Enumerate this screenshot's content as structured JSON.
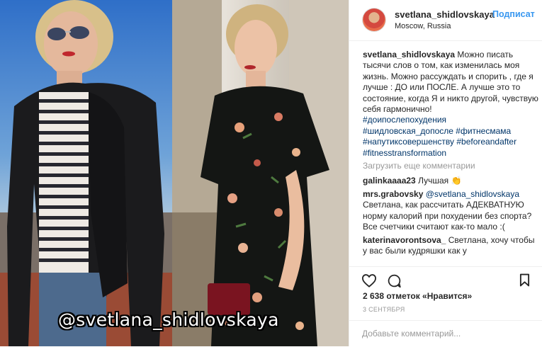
{
  "post": {
    "username": "svetlana_shidlovskaya",
    "follow_label": "Подписат",
    "location": "Moscow, Russia",
    "watermark": "@svetlana_shidlovskaya"
  },
  "caption": {
    "author": "svetlana_shidlovskaya",
    "text": "Можно писать тысячи слов о том, как изменилась моя жизнь. Можно рассуждать и спорить , где я лучше : ДО или ПОСЛЕ. А лучше это то состояние, когда Я и никто другой, чувствую себя гармонично!",
    "hashtags": [
      "#доипослепохудения",
      "#шидловская_допосле",
      "#фитнесмама",
      "#напутиксовершенству",
      "#beforeandafter",
      "#fitnesstransformation"
    ]
  },
  "load_more_label": "Загрузить еще комментарии",
  "comments": [
    {
      "author": "galinkaaaa23",
      "text": "Лучшая 👏"
    },
    {
      "author": "mrs.grabovsky",
      "mention": "@svetlana_shidlovskaya",
      "text": "Светлана, как рассчитать АДЕКВАТНУЮ норму калорий при похудении без спорта? Все счетчики считают как-то мало :("
    },
    {
      "author": "katerinavorontsova_",
      "text": "Светлана, хочу чтобы у вас были кудряшки как у"
    }
  ],
  "actions": {
    "like_icon": "heart-icon",
    "comment_icon": "comment-bubble-icon",
    "save_icon": "bookmark-icon"
  },
  "likes_label": "2 638 отметок «Нравится»",
  "date_label": "3 СЕНТЯБРЯ",
  "add_comment_placeholder": "Добавьте комментарий...",
  "colors": {
    "link": "#003569",
    "follow": "#3897f0",
    "muted": "#999999"
  }
}
